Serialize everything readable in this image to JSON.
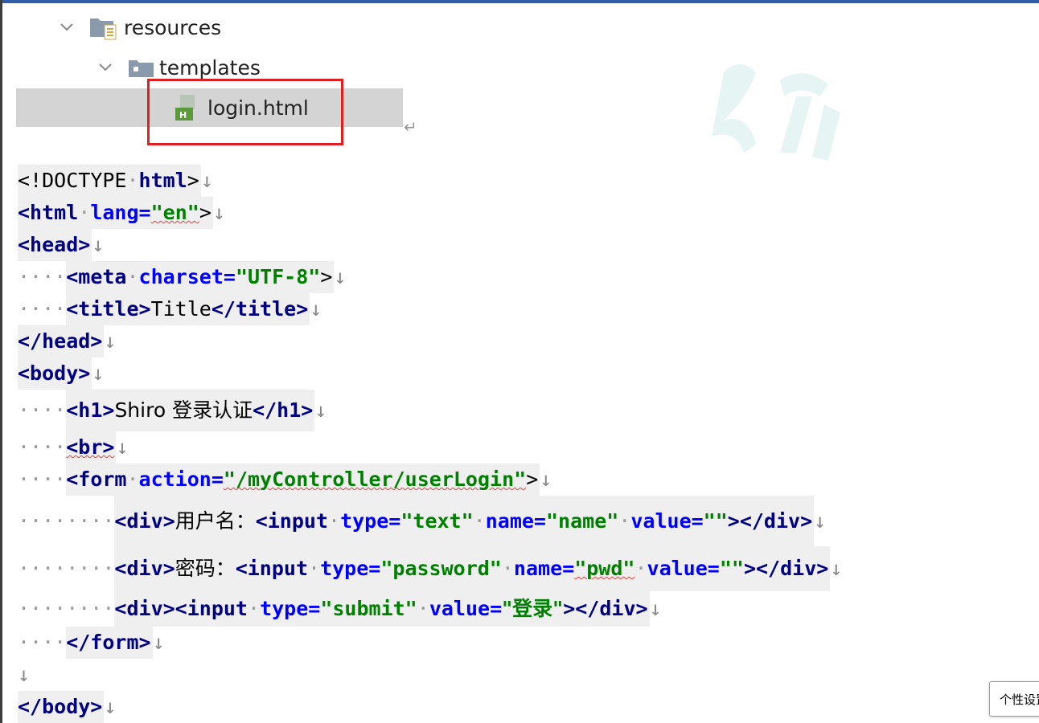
{
  "tree": {
    "folder_resources": "resources",
    "folder_templates": "templates",
    "file_login": "login.html"
  },
  "code_lines": [
    [
      "<",
      "!DOCTYPE",
      "html",
      ">"
    ],
    [
      "<html",
      "lang=",
      "\"en\"",
      ">"
    ],
    [
      "<head>"
    ],
    [
      "<meta",
      "charset=",
      "\"UTF-8\"",
      ">"
    ],
    [
      "<title>",
      "Title",
      "</title>"
    ],
    [
      "</head>"
    ],
    [
      "<body>"
    ],
    [
      "<h1>",
      "Shiro 登录认证",
      "</h1>"
    ],
    [
      "<br>"
    ],
    [
      "<form",
      "action=",
      "\"/myController/userLogin\"",
      ">"
    ],
    [
      "<div>",
      "用户名：",
      "<input",
      "type=",
      "\"text\"",
      "name=",
      "\"name\"",
      "value=",
      "\"\"",
      "></div>"
    ],
    [
      "<div>",
      "密码：",
      "<input",
      "type=",
      "\"password\"",
      "name=",
      "\"pwd\"",
      "value=",
      "\"\"",
      "></div>"
    ],
    [
      "<div><input",
      "type=",
      "\"submit\"",
      "value=",
      "\"登录\"",
      "></div>"
    ],
    [
      "</form>"
    ],
    [],
    [
      "</body>"
    ]
  ],
  "tooltip": "个性设置"
}
